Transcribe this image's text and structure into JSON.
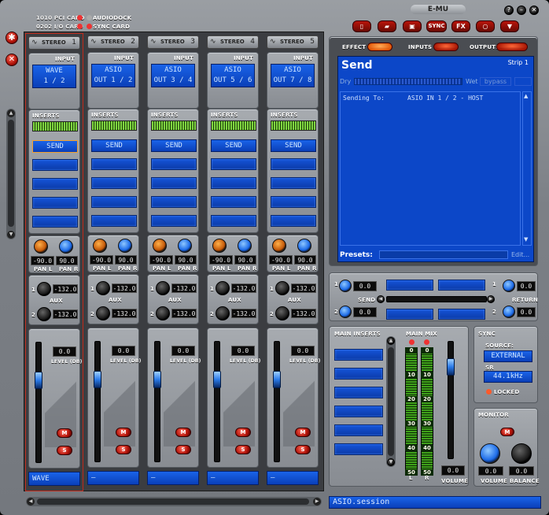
{
  "header": {
    "pci_card": "1010 PCI CARD",
    "audiodock": "AUDIODOCK",
    "io_card": "0202 I/O CARD",
    "sync_card": "SYNC CARD",
    "logo": "E-MU",
    "sync_label": "SYNC",
    "fx_label": "FX"
  },
  "strips": [
    {
      "title": "STEREO",
      "num": "1",
      "input": [
        "WAVE",
        "1 / 2"
      ],
      "send": "SEND",
      "pan_l": "-90.0",
      "pan_r": "90.0",
      "aux1": "-132.0",
      "aux2": "-132.0",
      "level": "0.0",
      "name": "WAVE",
      "active": true
    },
    {
      "title": "STEREO",
      "num": "2",
      "input": [
        "ASIO",
        "OUT 1 / 2"
      ],
      "send": "SEND",
      "pan_l": "-90.0",
      "pan_r": "90.0",
      "aux1": "-132.0",
      "aux2": "-132.0",
      "level": "0.0",
      "name": "–",
      "active": false
    },
    {
      "title": "STEREO",
      "num": "3",
      "input": [
        "ASIO",
        "OUT 3 / 4"
      ],
      "send": "SEND",
      "pan_l": "-90.0",
      "pan_r": "90.0",
      "aux1": "-132.0",
      "aux2": "-132.0",
      "level": "0.0",
      "name": "–",
      "active": false
    },
    {
      "title": "STEREO",
      "num": "4",
      "input": [
        "ASIO",
        "OUT 5 / 6"
      ],
      "send": "SEND",
      "pan_l": "-90.0",
      "pan_r": "90.0",
      "aux1": "-132.0",
      "aux2": "-132.0",
      "level": "0.0",
      "name": "–",
      "active": false
    },
    {
      "title": "STEREO",
      "num": "5",
      "input": [
        "ASIO",
        "OUT 7 / 8"
      ],
      "send": "SEND",
      "pan_l": "-90.0",
      "pan_r": "90.0",
      "aux1": "-132.0",
      "aux2": "-132.0",
      "level": "0.0",
      "name": "–",
      "active": false
    }
  ],
  "labels": {
    "input": "INPUT",
    "inserts": "INSERTS",
    "pan_l": "PAN L",
    "pan_r": "PAN R",
    "aux": "AUX",
    "level": "LEVEL (DB)",
    "mute": "M",
    "solo": "S",
    "one": "1",
    "two": "2"
  },
  "tabs": {
    "effect": "EFFECT",
    "inputs": "INPUTS",
    "outputs": "OUTPUTS"
  },
  "effect": {
    "title": "Send",
    "strip": "Strip 1",
    "dry": "Dry",
    "wet": "Wet",
    "bypass": "bypass",
    "sending_label": "Sending To:",
    "sending_value": "ASIO IN 1 / 2 - HOST",
    "presets": "Presets:",
    "edit": "Edit..."
  },
  "sendreturn": {
    "send_label": "SEND",
    "return_label": "RETURN",
    "send1": "0.0",
    "send2": "0.0",
    "ret1": "0.0",
    "ret2": "0.0"
  },
  "main": {
    "inserts_label": "MAIN INSERTS",
    "mix_label": "MAIN MIX",
    "scale": [
      "0",
      "10",
      "20",
      "30",
      "40",
      "50"
    ],
    "l": "L",
    "r": "R",
    "volume_label": "VOLUME",
    "volume": "0.0"
  },
  "sync": {
    "label": "SYNC",
    "source_label": "SOURCE:",
    "source": "EXTERNAL",
    "sr_label": "SR",
    "sr": "44.1kHz",
    "locked": "LOCKED"
  },
  "monitor": {
    "label": "MONITOR",
    "mute": "M",
    "volume": "0.0",
    "balance": "0.0",
    "volume_label": "VOLUME",
    "balance_label": "BALANCE"
  },
  "session": "ASIO.session"
}
